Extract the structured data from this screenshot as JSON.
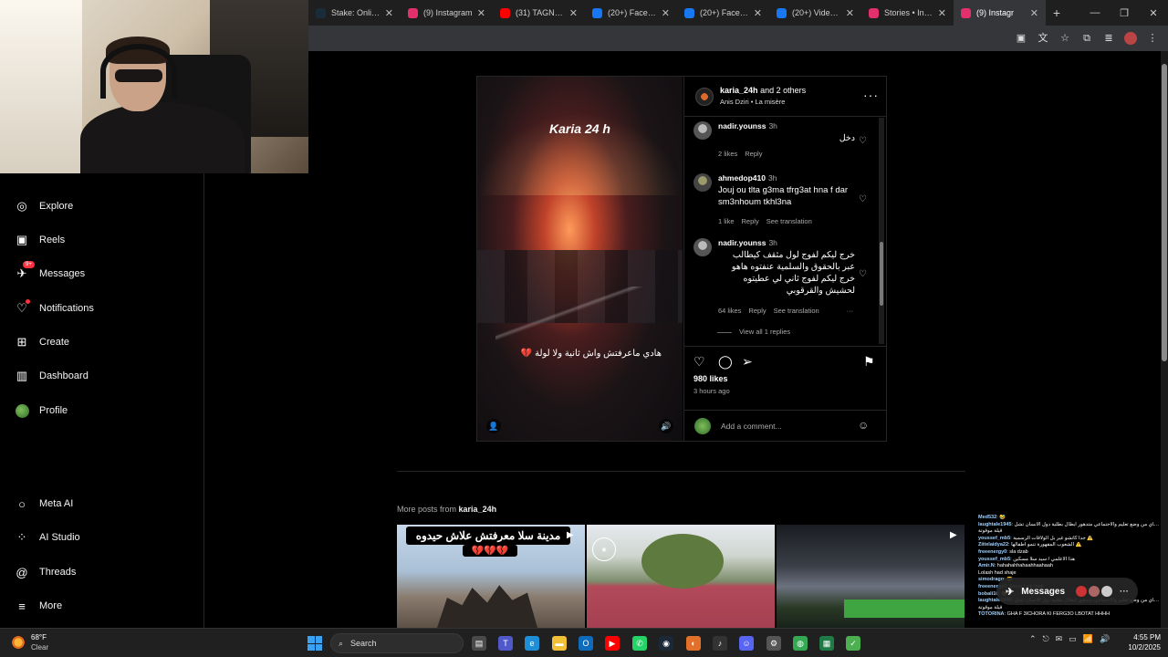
{
  "browser": {
    "tabs": [
      {
        "title": "Stake: Online C",
        "favicon_color": "#1a2c38",
        "active": false
      },
      {
        "title": "(9) Instagram",
        "favicon_color": "#e1306c",
        "active": false
      },
      {
        "title": "(31) TAGNE - L",
        "favicon_color": "#ff0000",
        "active": false
      },
      {
        "title": "(20+) Faceboo",
        "favicon_color": "#1877f2",
        "active": false
      },
      {
        "title": "(20+) Faceboo",
        "favicon_color": "#1877f2",
        "active": false
      },
      {
        "title": "(20+) Video | F",
        "favicon_color": "#1877f2",
        "active": false
      },
      {
        "title": "Stories • Insta",
        "favicon_color": "#e1306c",
        "active": false
      },
      {
        "title": "(9) Instagr",
        "favicon_color": "#e1306c",
        "active": true
      }
    ],
    "new_tab_glyph": "+",
    "close_glyph": "✕",
    "win_controls": [
      "—",
      "❐",
      "✕"
    ]
  },
  "nav": {
    "items": [
      {
        "label": "Explore",
        "icon": "compass-icon",
        "glyph": "◎"
      },
      {
        "label": "Reels",
        "icon": "reels-icon",
        "glyph": "▣"
      },
      {
        "label": "Messages",
        "icon": "messenger-icon",
        "glyph": "✈",
        "badge": "9+"
      },
      {
        "label": "Notifications",
        "icon": "heart-icon",
        "glyph": "♡",
        "dot": true
      },
      {
        "label": "Create",
        "icon": "plus-square-icon",
        "glyph": "⊞"
      },
      {
        "label": "Dashboard",
        "icon": "dashboard-icon",
        "glyph": "▥"
      },
      {
        "label": "Profile",
        "icon": "avatar",
        "glyph": ""
      }
    ],
    "bottom_items": [
      {
        "label": "Meta AI",
        "icon": "meta-ai-icon",
        "glyph": "○"
      },
      {
        "label": "AI Studio",
        "icon": "ai-studio-icon",
        "glyph": "⁘"
      },
      {
        "label": "Threads",
        "icon": "threads-icon",
        "glyph": "@"
      },
      {
        "label": "More",
        "icon": "menu-icon",
        "glyph": "≡"
      }
    ]
  },
  "post": {
    "video_title": "Karia 24 h",
    "video_caption": "هادي ماعرفتش واش ثانية ولا لولة 💔",
    "author": "karia_24h",
    "coauthors": "and 2 others",
    "audio": "Anis Dziri • La misère",
    "comments": [
      {
        "user": "nadir.younss",
        "time": "3h",
        "text": "دخل",
        "rtl": true,
        "likes": "2 likes",
        "reply": "Reply",
        "translate": ""
      },
      {
        "user": "ahmedop410",
        "time": "3h",
        "text": "Jouj ou tlta g3ma tfrg3at hna f dar sm3nhoum tkhl3na",
        "rtl": false,
        "likes": "1 like",
        "reply": "Reply",
        "translate": "See translation"
      },
      {
        "user": "nadir.younss",
        "time": "3h",
        "text": "خرج ليكم لفوج لول مثقف كيطالب عبر بالحقوق والسلمية عنفتوه هاهو خرج ليكم لفوج ثاني لي عطيتوه لحشيش والقرقوبي",
        "rtl": true,
        "likes": "64 likes",
        "reply": "Reply",
        "translate": "See translation"
      }
    ],
    "view_replies": "View all 1 replies",
    "likes": "980 likes",
    "time_ago": "3 hours ago",
    "add_comment_placeholder": "Add a comment..."
  },
  "more_posts": {
    "prefix": "More posts from",
    "user": "karia_24h",
    "tile1_caption": "مدينة سلا معرفتش علاش حيدوه",
    "tile1_hearts": "💔💔💔"
  },
  "chat_overlay": [
    {
      "name": "Med532",
      "text": ": 🤣"
    },
    {
      "name": "laughtale1945",
      "text": ": مشكل حقيقي بجاي من وضع تعليم والاجتماعي متدهور ابطال بطلية دول الانسان تشل"
    },
    {
      "name": "",
      "text": "قيلة موقوتة"
    },
    {
      "name": "youssef_mb5",
      "text": ": جدا كاتشو غير بل الولاقات الرسمية ⚠️"
    },
    {
      "name": "Ziitelaidya22",
      "text": ": الشعوب المقهورة تنمو أطفالها ⚠️"
    },
    {
      "name": "freeenergy0",
      "text": ": sla dzab"
    },
    {
      "name": "youssef_mb5",
      "text": ": هذا الاعلمي / سيد سلا مسكين"
    },
    {
      "name": "Amir.N",
      "text": ": hahahahhahaahhaahaah"
    },
    {
      "name": "",
      "text": "Lolash had shaje"
    },
    {
      "name": "simodrago",
      "text": ": 😂"
    },
    {
      "name": "freeenergy0",
      "text": ": 9arya f sla hadi"
    },
    {
      "name": "bobali10",
      "text": ": 😂"
    },
    {
      "name": "laughtale1945",
      "text": ": مشكل حقيقي بجاي من وضع تعليم والاجتماعي متدهور ابطال بطلية دول الانسان تشل"
    },
    {
      "name": "",
      "text": "قيلة موقوتة"
    },
    {
      "name": "TOTORINA",
      "text": ": GHA F 3ICHORA KI FERG3O LBOTAT HHHH"
    }
  ],
  "messages_pill": {
    "label": "Messages",
    "count": "45"
  },
  "taskbar": {
    "weather_temp": "68°F",
    "weather_cond": "Clear",
    "search_label": "Search",
    "time": "4:55 PM",
    "date": "10/2/2025",
    "tray_glyphs": [
      "⌃",
      "⎋",
      "✉",
      "▭",
      "📶",
      "🔊"
    ],
    "apps": [
      {
        "name": "task-view-icon",
        "color": "#4a4a4a",
        "glyph": "▤"
      },
      {
        "name": "teams-icon",
        "color": "#5059c9",
        "glyph": "T"
      },
      {
        "name": "edge-icon",
        "color": "#1e8fd6",
        "glyph": "e"
      },
      {
        "name": "file-explorer-icon",
        "color": "#f2c037",
        "glyph": "▬"
      },
      {
        "name": "outlook-icon",
        "color": "#0f6cbd",
        "glyph": "O"
      },
      {
        "name": "youtube-icon",
        "color": "#ff0000",
        "glyph": "▶"
      },
      {
        "name": "whatsapp-icon",
        "color": "#25d366",
        "glyph": "✆"
      },
      {
        "name": "steam-icon",
        "color": "#1b2838",
        "glyph": "◉"
      },
      {
        "name": "obs-icon",
        "color": "#e2702a",
        "glyph": "◐"
      },
      {
        "name": "audio-app-icon",
        "color": "#333",
        "glyph": "♪"
      },
      {
        "name": "discord-icon",
        "color": "#5865f2",
        "glyph": "☺"
      },
      {
        "name": "settings-icon",
        "color": "#555",
        "glyph": "⚙"
      },
      {
        "name": "chrome-icon",
        "color": "#34a853",
        "glyph": "◍"
      },
      {
        "name": "sheets-icon",
        "color": "#1e7b45",
        "glyph": "▦"
      },
      {
        "name": "app-green-icon",
        "color": "#4caf50",
        "glyph": "✓"
      }
    ]
  }
}
